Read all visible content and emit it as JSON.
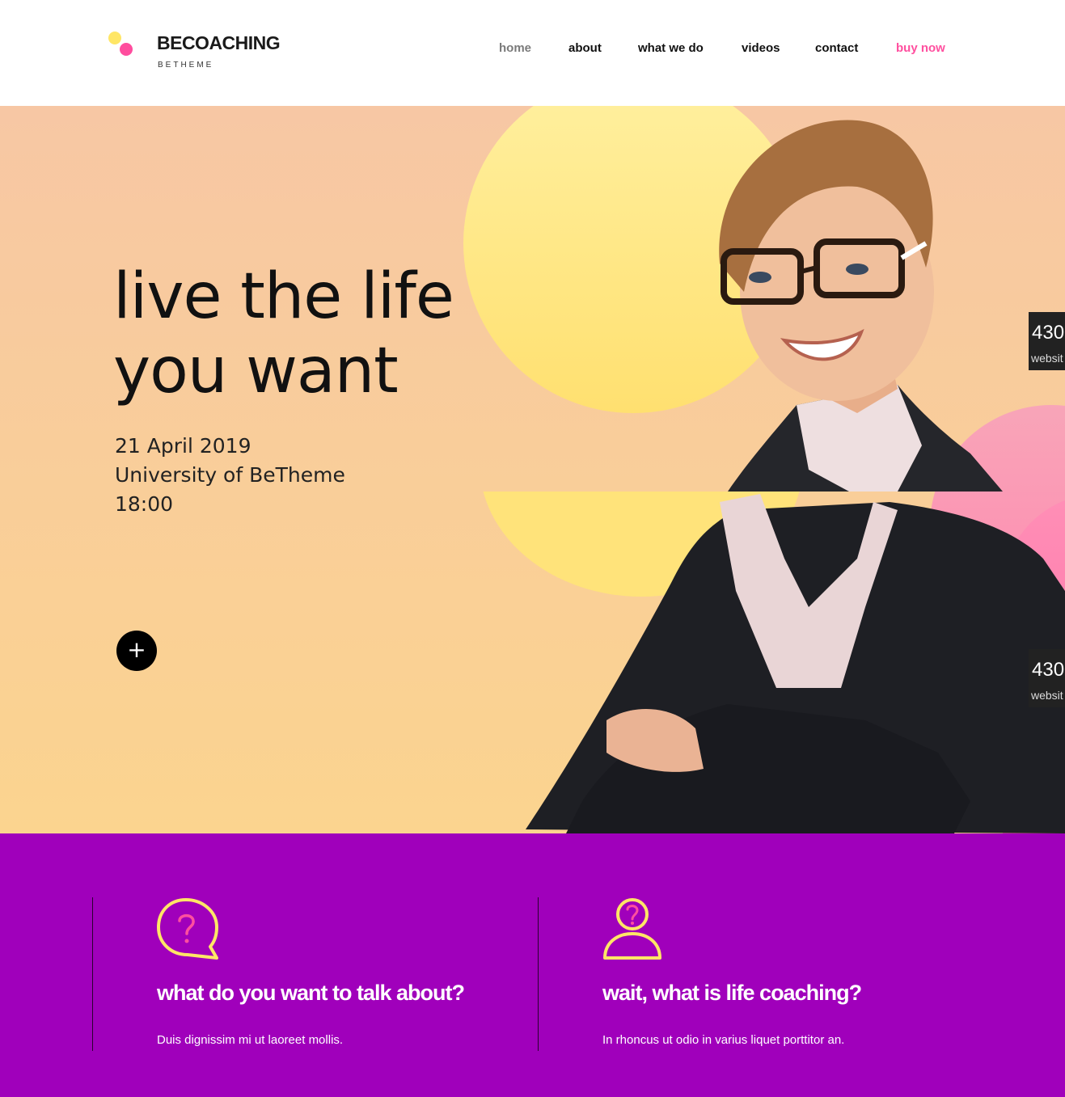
{
  "brand": {
    "name": "BECOACHING",
    "tagline": "BETHEME",
    "dot_colors": [
      "#ffe666",
      "#ff4d9e"
    ]
  },
  "nav": {
    "items": [
      {
        "label": "home",
        "state": "active"
      },
      {
        "label": "about"
      },
      {
        "label": "what we do"
      },
      {
        "label": "videos"
      },
      {
        "label": "contact"
      },
      {
        "label": "buy now",
        "state": "highlight"
      }
    ]
  },
  "hero": {
    "headline_line1": "live the life",
    "headline_line2": "you want",
    "date": "21 April 2019",
    "venue": "University of BeTheme",
    "time": "18:00",
    "plus_button": "+"
  },
  "badges": [
    {
      "number": "430",
      "label": "websit"
    },
    {
      "number": "430",
      "label": "websit"
    }
  ],
  "features": [
    {
      "icon": "speech-bubble-question-icon",
      "title": "what do you want to talk about?",
      "text": "Duis dignissim mi ut laoreet mollis."
    },
    {
      "icon": "person-question-icon",
      "title": "wait, what is life coaching?",
      "text": "In rhoncus ut odio in varius liquet porttitor an."
    }
  ],
  "colors": {
    "accent_pink": "#ff4f9f",
    "purple": "#a000bb",
    "icon_yellow": "#ffe666"
  }
}
